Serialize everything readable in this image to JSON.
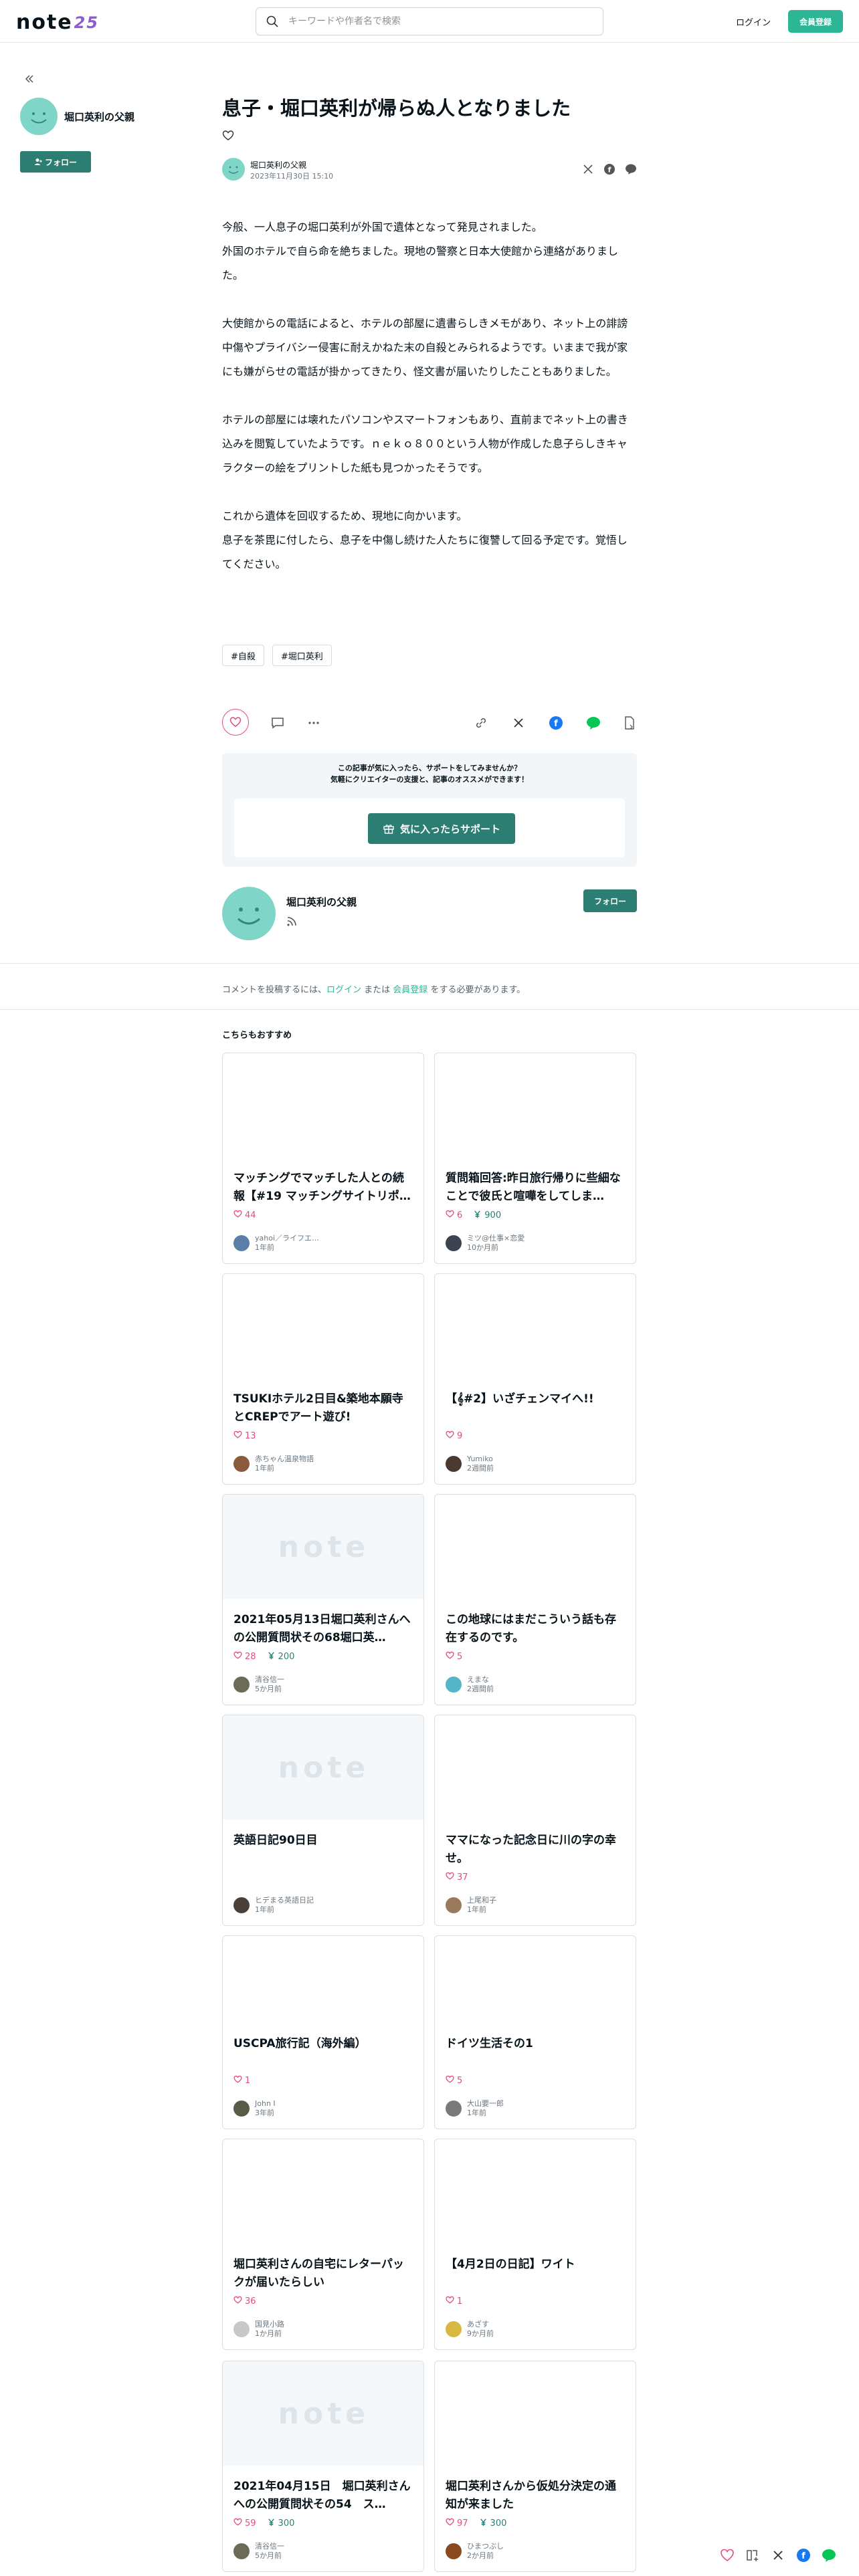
{
  "header": {
    "logo_text": "note",
    "logo_num": "25",
    "search_placeholder": "キーワードや作者名で検索",
    "login_label": "ログイン",
    "signup_label": "会員登録"
  },
  "profile": {
    "name": "堀口英利の父親",
    "follow_label": "フォロー"
  },
  "article": {
    "title": "息子・堀口英利が帰らぬ人となりました",
    "author": "堀口英利の父親",
    "date": "2023年11月30日 15:10",
    "paragraphs": [
      [
        "今般、一人息子の堀口英利が外国で遺体となって発見されました。",
        "外国のホテルで自ら命を絶ちました。現地の警察と日本大使館から連絡がありました。"
      ],
      [
        "大使館からの電話によると、ホテルの部屋に遺書らしきメモがあり、ネット上の誹謗中傷やプライバシー侵害に耐えかねた末の自殺とみられるようです。いままで我が家にも嫌がらせの電話が掛かってきたり、怪文書が届いたりしたこともありました。"
      ],
      [
        "ホテルの部屋には壊れたパソコンやスマートフォンもあり、直前までネット上の書き込みを閲覧していたようです。ｎｅｋｏ８００という人物が作成した息子らしきキャラクターの絵をプリントした紙も見つかったそうです。"
      ],
      [
        "これから遺体を回収するため、現地に向かいます。",
        "息子を茶毘に付したら、息子を中傷し続けた人たちに復讐して回る予定です。覚悟してください。"
      ]
    ],
    "tags": [
      "#自殺",
      "#堀口英利"
    ]
  },
  "support": {
    "line1": "この記事が気に入ったら、サポートをしてみませんか？",
    "line2": "気軽にクリエイターの支援と、記事のオススメができます！",
    "button_label": "気に入ったらサポート"
  },
  "bottom_author": {
    "name": "堀口英利の父親",
    "follow_label": "フォロー"
  },
  "comment": {
    "prefix": "コメントを投稿するには、",
    "login": "ログイン",
    "middle": " または ",
    "signup": "会員登録",
    "suffix": " をする必要があります。"
  },
  "recommend": {
    "title": "こちらもおすすめ",
    "placeholder_logo": "note",
    "cards": [
      {
        "title": "マッチングでマッチした人との続報【#19 マッチングサイトリポ…",
        "likes": "44",
        "yen": "",
        "author": "yahoi／ライフエ…",
        "time": "1年前",
        "thumb": false,
        "avatar": "#5a7ea8"
      },
      {
        "title": "質問箱回答:昨日旅行帰りに些細なことで彼氏と喧嘩をしてしま…",
        "likes": "6",
        "yen": "900",
        "author": "ミツ@仕事×恋愛",
        "time": "10か月前",
        "thumb": false,
        "avatar": "#3b4450"
      },
      {
        "title": "TSUKIホテル2日目&築地本願寺とCREPでアート遊び!",
        "likes": "13",
        "yen": "",
        "author": "赤ちゃん温泉物語",
        "time": "1年前",
        "thumb": false,
        "avatar": "#8a5a3c"
      },
      {
        "title": "【𝄞#2】いざチェンマイへ!!",
        "likes": "9",
        "yen": "",
        "author": "Yumiko",
        "time": "2週間前",
        "thumb": false,
        "avatar": "#4a3a30"
      },
      {
        "title": "2021年05月13日堀口英利さんへの公開質問状その68堀口英…",
        "likes": "28",
        "yen": "200",
        "author": "清谷信一",
        "time": "5か月前",
        "thumb": true,
        "avatar": "#6b6b5a"
      },
      {
        "title": "この地球にはまだこういう話も存在するのです。",
        "likes": "5",
        "yen": "",
        "author": "えまな",
        "time": "2週間前",
        "thumb": false,
        "avatar": "#56b6c8"
      },
      {
        "title": "英語日記90日目",
        "likes": "",
        "yen": "",
        "author": "ヒデまる英語日記",
        "time": "1年前",
        "thumb": true,
        "avatar": "#4a4038"
      },
      {
        "title": "ママになった記念日に川の字の幸せ。",
        "likes": "37",
        "yen": "",
        "author": "上尾和子",
        "time": "1年前",
        "thumb": false,
        "avatar": "#9a7a5a"
      },
      {
        "title": "USCPA旅行記（海外編）",
        "likes": "1",
        "yen": "",
        "author": "John I",
        "time": "3年前",
        "thumb": false,
        "avatar": "#5a5a48"
      },
      {
        "title": "ドイツ生活その1",
        "likes": "5",
        "yen": "",
        "author": "大山要一郎",
        "time": "1年前",
        "thumb": false,
        "avatar": "#7a7a7a"
      },
      {
        "title": "堀口英利さんの自宅にレターパックが届いたらしい",
        "likes": "36",
        "yen": "",
        "author": "国見小路",
        "time": "1か月前",
        "thumb": false,
        "avatar": "#c8c8c8"
      },
      {
        "title": "【4月2日の日記】ワイト",
        "likes": "1",
        "yen": "",
        "author": "あざす",
        "time": "9か月前",
        "thumb": false,
        "avatar": "#d8b840"
      },
      {
        "title": "2021年04月15日　堀口英利さんへの公開質問状その54　ス…",
        "likes": "59",
        "yen": "300",
        "author": "清谷信一",
        "time": "5か月前",
        "thumb": true,
        "avatar": "#6b6b5a"
      },
      {
        "title": "堀口英利さんから仮処分決定の通知が来ました",
        "likes": "97",
        "yen": "300",
        "author": "ひまつぶし",
        "time": "2か月前",
        "thumb": false,
        "avatar": "#8a4a20"
      }
    ]
  },
  "colors": {
    "accent": "#2cb696",
    "follow": "#2c7d72",
    "like": "#e04f79"
  }
}
